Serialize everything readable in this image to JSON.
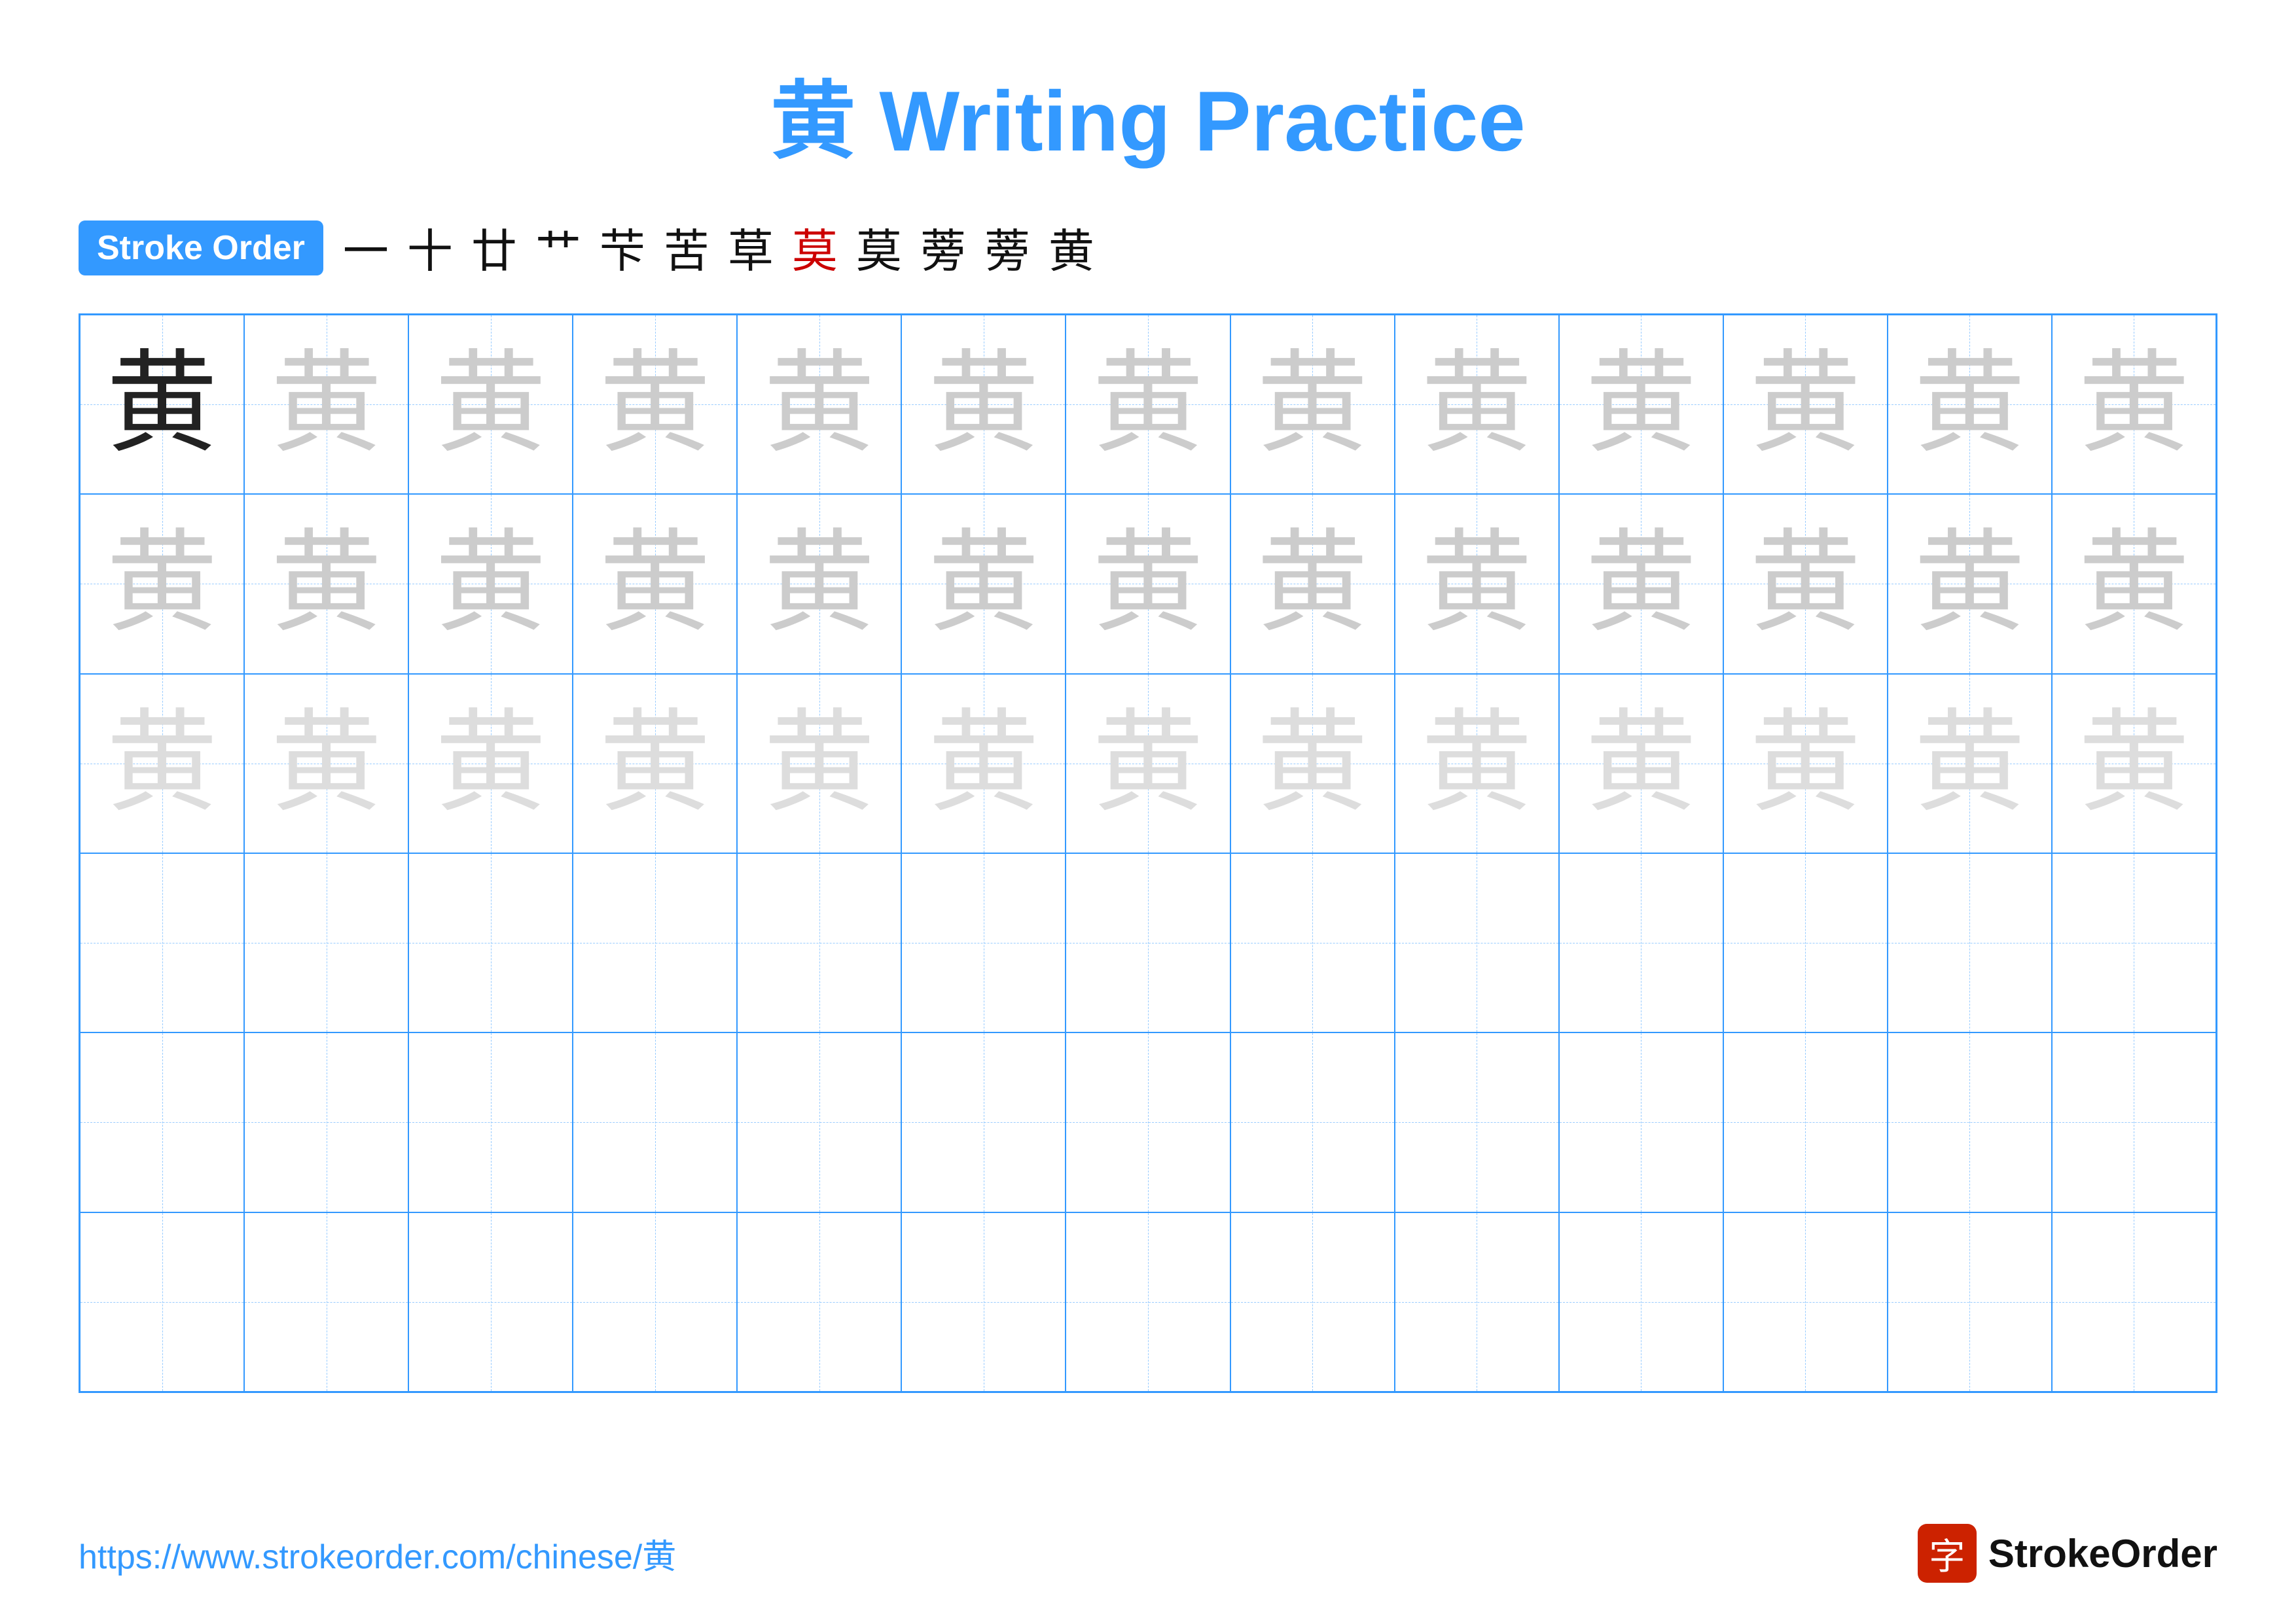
{
  "title": "黄 Writing Practice",
  "stroke_order": {
    "badge_label": "Stroke Order",
    "strokes": [
      {
        "char": "一",
        "red": false
      },
      {
        "char": "十",
        "red": false
      },
      {
        "char": "廿",
        "red": false
      },
      {
        "char": "艹",
        "red": false
      },
      {
        "char": "芐",
        "red": false
      },
      {
        "char": "苦",
        "red": false
      },
      {
        "char": "草",
        "red": false
      },
      {
        "char": "莫",
        "red": true
      },
      {
        "char": "莫",
        "red": false
      },
      {
        "char": "蒡",
        "red": false
      },
      {
        "char": "蒡",
        "red": false
      },
      {
        "char": "黄",
        "red": false
      }
    ]
  },
  "grid": {
    "rows": 6,
    "cols": 13,
    "character": "黄",
    "cells": [
      "dark",
      "light1",
      "light1",
      "light1",
      "light1",
      "light1",
      "light1",
      "light1",
      "light1",
      "light1",
      "light1",
      "light1",
      "light1",
      "light1",
      "light1",
      "light1",
      "light1",
      "light1",
      "light1",
      "light1",
      "light1",
      "light1",
      "light1",
      "light1",
      "light1",
      "light1",
      "light2",
      "light2",
      "light2",
      "light2",
      "light2",
      "light2",
      "light2",
      "light2",
      "light2",
      "light2",
      "light2",
      "light2",
      "light2",
      "empty",
      "empty",
      "empty",
      "empty",
      "empty",
      "empty",
      "empty",
      "empty",
      "empty",
      "empty",
      "empty",
      "empty",
      "empty",
      "empty",
      "empty",
      "empty",
      "empty",
      "empty",
      "empty",
      "empty",
      "empty",
      "empty",
      "empty",
      "empty",
      "empty",
      "empty",
      "empty",
      "empty",
      "empty",
      "empty",
      "empty",
      "empty",
      "empty",
      "empty",
      "empty",
      "empty",
      "empty",
      "empty",
      "empty"
    ]
  },
  "footer": {
    "url": "https://www.strokeorder.com/chinese/黄",
    "logo_char": "字",
    "logo_text": "StrokeOrder"
  }
}
